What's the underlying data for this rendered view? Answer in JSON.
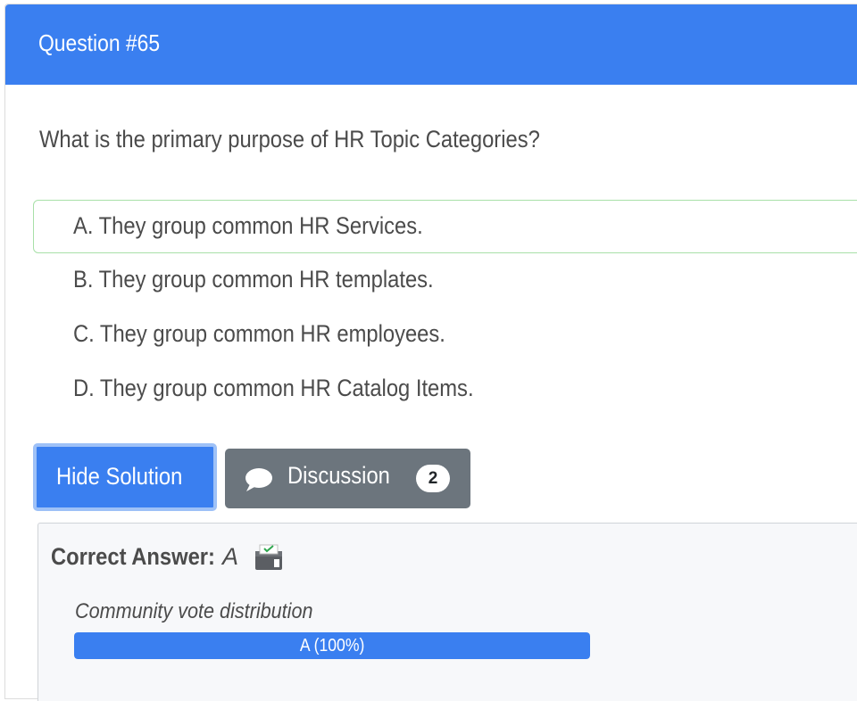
{
  "header": {
    "title": "Question #65"
  },
  "question": {
    "text": "What is the primary purpose of HR Topic Categories?"
  },
  "choices": [
    {
      "label": "A. They group common HR Services.",
      "correct": true
    },
    {
      "label": "B. They group common HR templates.",
      "correct": false
    },
    {
      "label": "C. They group common HR employees.",
      "correct": false
    },
    {
      "label": "D. They group common HR Catalog Items.",
      "correct": false
    }
  ],
  "buttons": {
    "hide_solution": "Hide Solution",
    "discussion": "Discussion",
    "discussion_count": "2",
    "discussion_icon": "comment-icon"
  },
  "answer": {
    "label": "Correct Answer:",
    "value": "A",
    "vote_icon": "ballot-box-check-icon",
    "distribution_label": "Community vote distribution",
    "distribution": [
      {
        "label": "A (100%)",
        "fraction": 1.0
      }
    ]
  },
  "colors": {
    "primary": "#3a7ff0",
    "secondary": "#6c757d",
    "correct_border": "#a8e0a8"
  }
}
